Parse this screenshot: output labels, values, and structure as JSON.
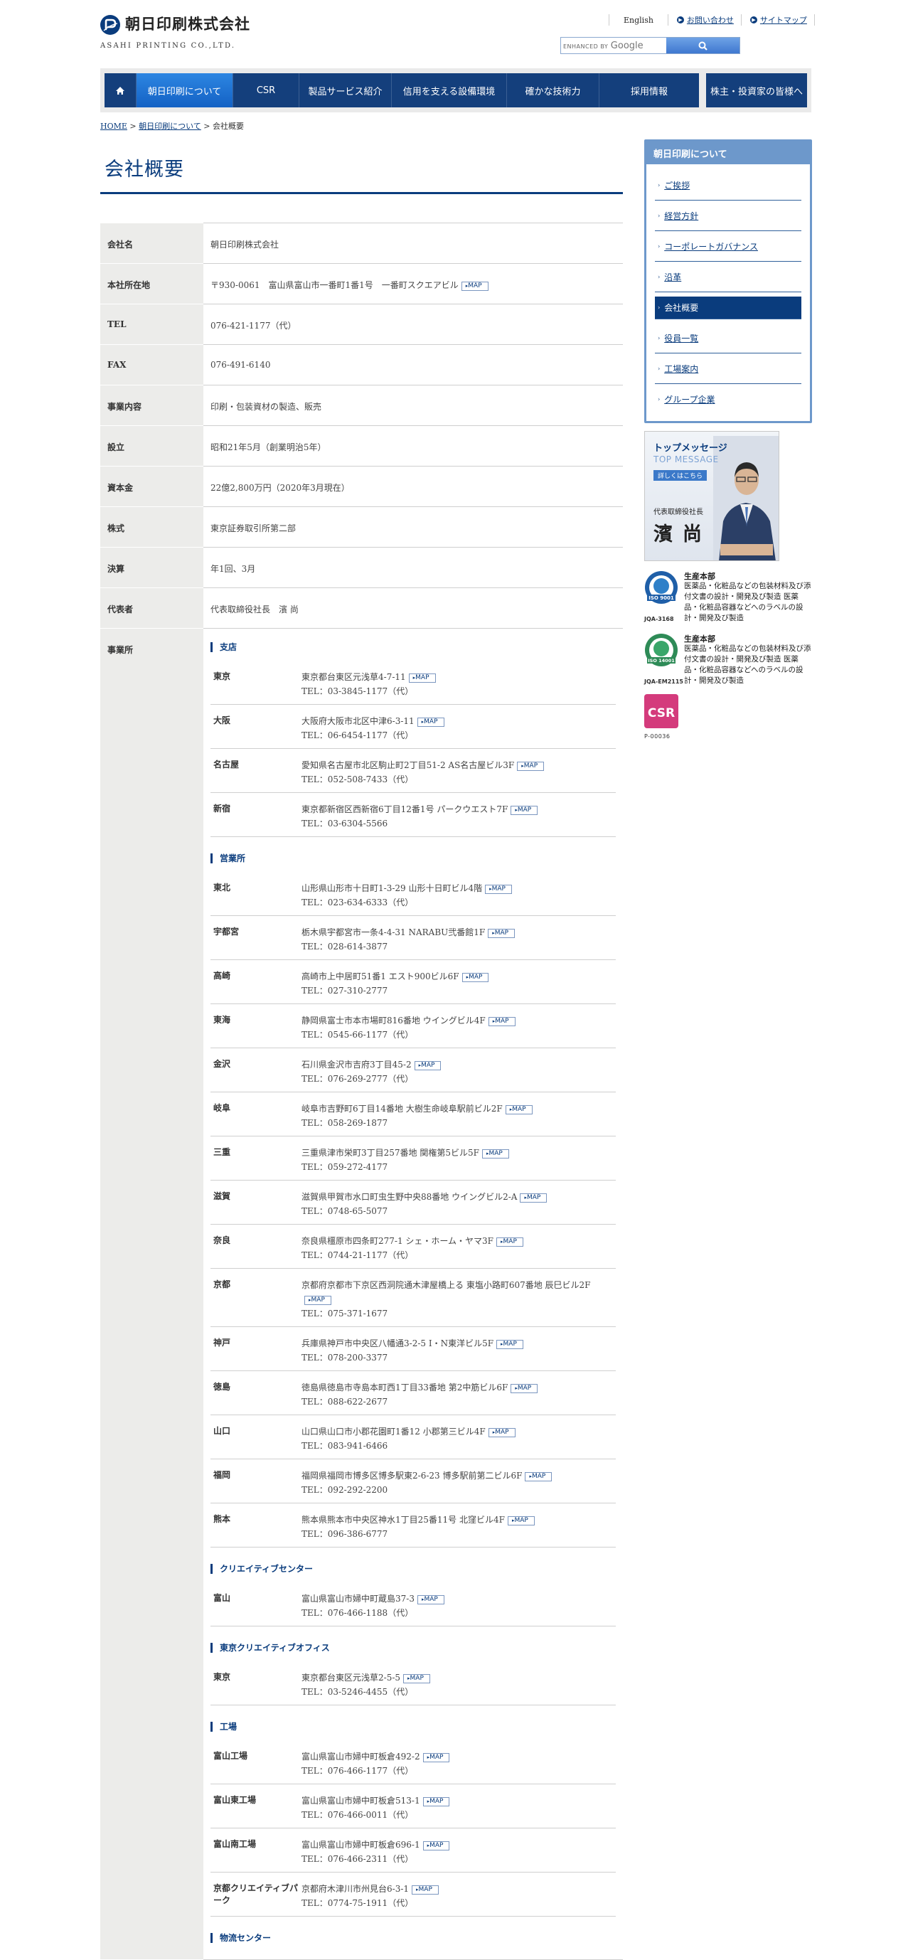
{
  "header": {
    "company_name": "朝日印刷株式会社",
    "company_en": "ASAHI PRINTING CO.,LTD.",
    "links": {
      "english": "English",
      "contact": "お問い合わせ",
      "sitemap": "サイトマップ"
    },
    "search": {
      "enhanced_by": "ENHANCED BY",
      "google": "Google"
    }
  },
  "nav": {
    "items": [
      "朝日印刷について",
      "CSR",
      "製品サービス紹介",
      "信用を支える設備環境",
      "確かな技術力",
      "採用情報"
    ],
    "ir": "株主・投資家の皆様へ"
  },
  "breadcrumb": {
    "home": "HOME",
    "sep1": " > ",
    "about": "朝日印刷について",
    "sep2": " > ",
    "current": "会社概要"
  },
  "page_title": "会社概要",
  "overview": [
    {
      "label": "会社名",
      "value": "朝日印刷株式会社"
    },
    {
      "label": "本社所在地",
      "value": "〒930-0061　富山県富山市一番町1番1号　一番町スクエアビル",
      "map": true
    },
    {
      "label": "TEL",
      "value": "076-421-1177（代）"
    },
    {
      "label": "FAX",
      "value": "076-491-6140"
    },
    {
      "label": "事業内容",
      "value": "印刷・包装資材の製造、販売"
    },
    {
      "label": "設立",
      "value": "昭和21年5月（創業明治5年）"
    },
    {
      "label": "資本金",
      "value": "22億2,800万円（2020年3月現在）"
    },
    {
      "label": "株式",
      "value": "東京証券取引所第二部"
    },
    {
      "label": "決算",
      "value": "年1回、3月"
    },
    {
      "label": "代表者",
      "value": "代表取締役社長　濱 尚"
    }
  ],
  "offices_label": "事業所",
  "map_label": "MAP",
  "offices": [
    {
      "section": "支店",
      "items": [
        {
          "name": "東京",
          "addr": "東京都台東区元浅草4-7-11",
          "tel": "TEL：03-3845-1177（代）"
        },
        {
          "name": "大阪",
          "addr": "大阪府大阪市北区中津6-3-11",
          "tel": "TEL：06-6454-1177（代）"
        },
        {
          "name": "名古屋",
          "addr": "愛知県名古屋市北区駒止町2丁目51-2 AS名古屋ビル3F",
          "tel": "TEL：052-508-7433（代）"
        },
        {
          "name": "新宿",
          "addr": "東京都新宿区西新宿6丁目12番1号 パークウエスト7F",
          "tel": "TEL：03-6304-5566"
        }
      ]
    },
    {
      "section": "営業所",
      "items": [
        {
          "name": "東北",
          "addr": "山形県山形市十日町1-3-29 山形十日町ビル4階",
          "tel": "TEL：023-634-6333（代）"
        },
        {
          "name": "宇都宮",
          "addr": "栃木県宇都宮市一条4-4-31 NARABU弐番館1F",
          "tel": "TEL：028-614-3877"
        },
        {
          "name": "高崎",
          "addr": "高崎市上中居町51番1 エスト900ビル6F",
          "tel": "TEL：027-310-2777"
        },
        {
          "name": "東海",
          "addr": "静岡県富士市本市場町816番地 ウイングビル4F",
          "tel": "TEL：0545-66-1177（代）"
        },
        {
          "name": "金沢",
          "addr": "石川県金沢市吉府3丁目45-2",
          "tel": "TEL：076-269-2777（代）"
        },
        {
          "name": "岐阜",
          "addr": "岐阜市吉野町6丁目14番地 大樹生命岐阜駅前ビル2F",
          "tel": "TEL：058-269-1877"
        },
        {
          "name": "三重",
          "addr": "三重県津市栄町3丁目257番地 関権第5ビル5F",
          "tel": "TEL：059-272-4177"
        },
        {
          "name": "滋賀",
          "addr": "滋賀県甲賀市水口町虫生野中央88番地 ウイングビル2-A",
          "tel": "TEL：0748-65-5077"
        },
        {
          "name": "奈良",
          "addr": "奈良県橿原市四条町277-1 シェ・ホーム・ヤマ3F",
          "tel": "TEL：0744-21-1177（代）"
        },
        {
          "name": "京都",
          "addr": "京都府京都市下京区西洞院通木津屋橋上る 東塩小路町607番地 辰巳ビル2F",
          "tel": "TEL：075-371-1677"
        },
        {
          "name": "神戸",
          "addr": "兵庫県神戸市中央区八幡通3-2-5 I・N東洋ビル5F",
          "tel": "TEL：078-200-3377"
        },
        {
          "name": "徳島",
          "addr": "徳島県徳島市寺島本町西1丁目33番地 第2中筋ビル6F",
          "tel": "TEL：088-622-2677"
        },
        {
          "name": "山口",
          "addr": "山口県山口市小郡花園町1番12 小郡第三ビル4F",
          "tel": "TEL：083-941-6466"
        },
        {
          "name": "福岡",
          "addr": "福岡県福岡市博多区博多駅東2-6-23 博多駅前第二ビル6F",
          "tel": "TEL：092-292-2200"
        },
        {
          "name": "熊本",
          "addr": "熊本県熊本市中央区神水1丁目25番11号 北窪ビル4F",
          "tel": "TEL：096-386-6777"
        }
      ]
    },
    {
      "section": "クリエイティブセンター",
      "items": [
        {
          "name": "富山",
          "addr": "富山県富山市婦中町蔵島37-3",
          "tel": "TEL：076-466-1188（代）"
        }
      ]
    },
    {
      "section": "東京クリエイティブオフィス",
      "items": [
        {
          "name": "東京",
          "addr": "東京都台東区元浅草2-5-5",
          "tel": "TEL：03-5246-4455（代）"
        }
      ]
    },
    {
      "section": "工場",
      "items": [
        {
          "name": "富山工場",
          "addr": "富山県富山市婦中町板倉492-2",
          "tel": "TEL：076-466-1177（代）"
        },
        {
          "name": "富山東工場",
          "addr": "富山県富山市婦中町板倉513-1",
          "tel": "TEL：076-466-0011（代）"
        },
        {
          "name": "富山南工場",
          "addr": "富山県富山市婦中町板倉696-1",
          "tel": "TEL：076-466-2311（代）"
        },
        {
          "name": "京都クリエイティブパーク",
          "addr": "京都府木津川市州見台6-3-1",
          "tel": "TEL：0774-75-1911（代）"
        }
      ]
    },
    {
      "section": "物流センター",
      "items": []
    }
  ],
  "sidebar": {
    "heading": "朝日印刷について",
    "items": [
      {
        "label": "ご挨拶",
        "current": false
      },
      {
        "label": "経営方針",
        "current": false
      },
      {
        "label": "コーポレートガバナンス",
        "current": false
      },
      {
        "label": "沿革",
        "current": false
      },
      {
        "label": "会社概要",
        "current": true
      },
      {
        "label": "役員一覧",
        "current": false
      },
      {
        "label": "工場案内",
        "current": false
      },
      {
        "label": "グループ企業",
        "current": false
      }
    ],
    "top_message": {
      "title": "トップメッセージ",
      "subtitle": "TOP MESSAGE",
      "more": "詳しくはこちら",
      "caption": "代表取締役社長",
      "name": "濱尚"
    },
    "iso": [
      {
        "badge": "ISO 9001",
        "code": "JQA-3168",
        "title": "生産本部",
        "text": "医薬品・化粧品などの包装材料及び添付文書の設計・開発及び製造 医薬品・化粧品容器などへのラベルの設計・開発及び製造"
      },
      {
        "badge": "ISO 14001",
        "code": "JQA-EM2115",
        "title": "生産本部",
        "text": "医薬品・化粧品などの包装材料及び添付文書の設計・開発及び製造 医薬品・化粧品容器などへのラベルの設計・開発及び製造"
      }
    ],
    "csr": {
      "label": "CSR",
      "code": "P-00036"
    }
  }
}
